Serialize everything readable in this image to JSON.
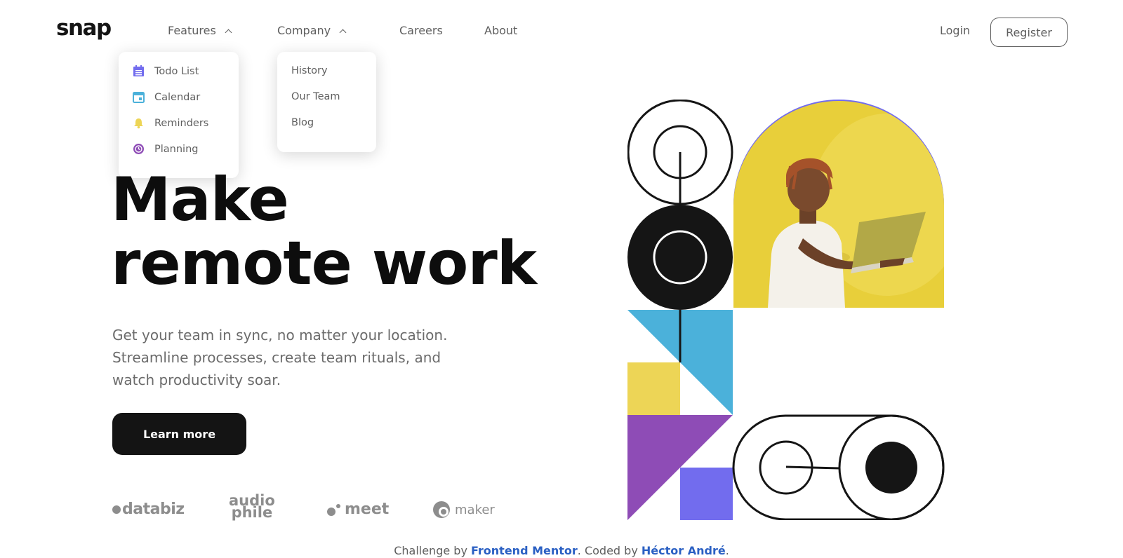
{
  "header": {
    "logo": "snap",
    "nav": [
      {
        "label": "Features"
      },
      {
        "label": "Company"
      },
      {
        "label": "Careers"
      },
      {
        "label": "About"
      }
    ],
    "login_label": "Login",
    "register_label": "Register"
  },
  "features_menu": {
    "items": [
      {
        "label": "Todo List",
        "icon": "todo-icon",
        "color": "#726cee"
      },
      {
        "label": "Calendar",
        "icon": "calendar-icon",
        "color": "#4bb1da"
      },
      {
        "label": "Reminders",
        "icon": "bell-icon",
        "color": "#edd556"
      },
      {
        "label": "Planning",
        "icon": "planning-icon",
        "color": "#8e4cb6"
      }
    ]
  },
  "company_menu": {
    "items": [
      {
        "label": "History"
      },
      {
        "label": "Our Team"
      },
      {
        "label": "Blog"
      }
    ]
  },
  "hero": {
    "title_line1": "Make",
    "title_line2": "remote work",
    "subtitle": "Get your team in sync, no matter your location. Streamline processes, create team rituals, and watch productivity soar.",
    "cta_label": "Learn more"
  },
  "clients": [
    {
      "name": "databiz"
    },
    {
      "name": "audio",
      "name2": "phile"
    },
    {
      "name": "meet"
    },
    {
      "name": "maker"
    }
  ],
  "footer": {
    "prefix": "Challenge by ",
    "link1": "Frontend Mentor",
    "middle": ". Coded by ",
    "link2": "Héctor André",
    "suffix": "."
  },
  "colors": {
    "purple": "#726cee",
    "blue": "#4bb1da",
    "yellow": "#edd556",
    "violet": "#8e4cb6",
    "dark": "#141414",
    "link": "#2b60c3"
  }
}
